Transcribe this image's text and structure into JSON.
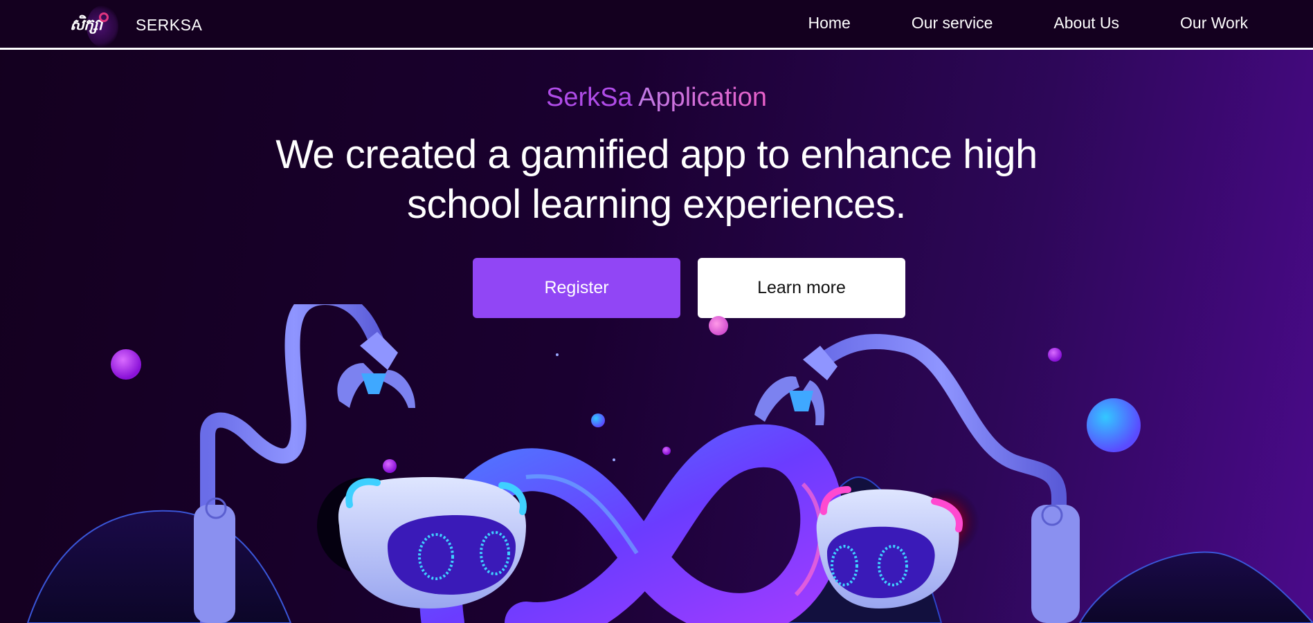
{
  "nav": {
    "brand_name": "SERKSA",
    "logo_text": "សិក្សា",
    "links": [
      "Home",
      "Our service",
      "About Us",
      "Our Work"
    ]
  },
  "hero": {
    "subtitle_part1": "SerkSa",
    "subtitle_part2": "Application",
    "title": "We created a gamified app to enhance high school learning experiences.",
    "register_label": "Register",
    "learn_more_label": "Learn more"
  },
  "colors": {
    "background": "#14001f",
    "accent_purple": "#9146f5",
    "subtitle_purple": "#b04ce8",
    "subtitle_pink": "#e860c8"
  },
  "icons": [
    "serksa-logo-icon",
    "robot-left-icon",
    "robot-right-icon",
    "infinity-loop-icon"
  ]
}
